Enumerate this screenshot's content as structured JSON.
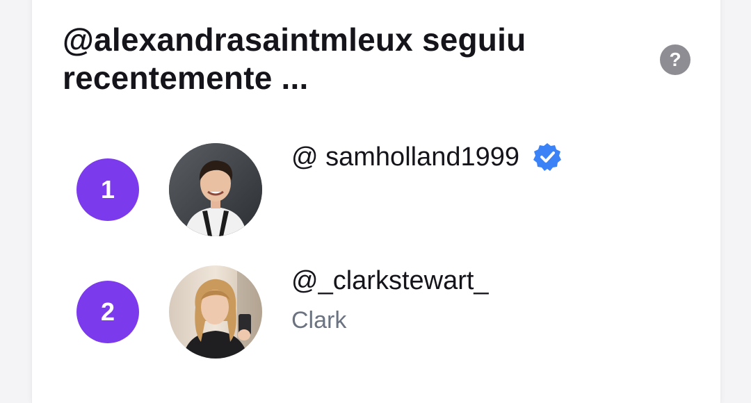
{
  "header": {
    "title": "@alexandrasaintmleux seguiu recentemente ...",
    "help_label": "?"
  },
  "colors": {
    "rank_badge": "#7c3aed",
    "verified_badge": "#3b82f6",
    "help_icon": "#8d8d93"
  },
  "list": [
    {
      "rank": "1",
      "handle": "@ samholland1999",
      "name": "",
      "verified": true
    },
    {
      "rank": "2",
      "handle": "@_clarkstewart_",
      "name": "Clark",
      "verified": false
    }
  ]
}
